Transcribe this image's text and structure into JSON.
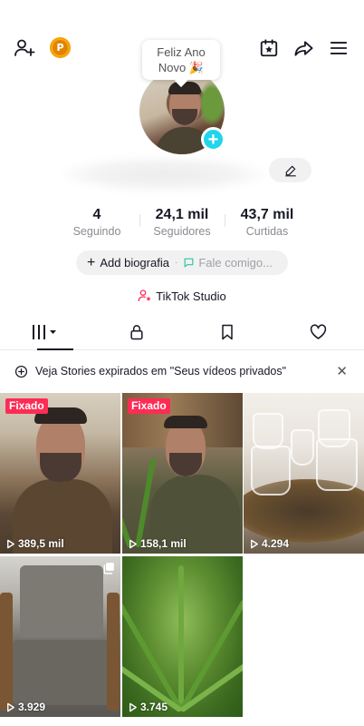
{
  "header": {
    "add_friend_icon": "person-add-icon",
    "coin_letter": "P",
    "calendar_icon": "calendar-star-icon",
    "share_icon": "share-arrow-icon",
    "menu_icon": "hamburger-menu-icon"
  },
  "profile": {
    "note_text_line1": "Feliz Ano",
    "note_text_line2": "Novo 🎉",
    "edit_icon": "pencil-icon",
    "stats": [
      {
        "value": "4",
        "label": "Seguindo"
      },
      {
        "value": "24,1 mil",
        "label": "Seguidores"
      },
      {
        "value": "43,7 mil",
        "label": "Curtidas"
      }
    ],
    "bio_button_label": "Add biografia",
    "bio_separator": "·",
    "bio_message_label": "Fale comigo...",
    "studio_label": "TikTok Studio"
  },
  "tabs": [
    {
      "name": "videos",
      "icon": "grid-bars-icon"
    },
    {
      "name": "private",
      "icon": "lock-icon"
    },
    {
      "name": "saved",
      "icon": "bookmark-icon"
    },
    {
      "name": "liked",
      "icon": "heart-icon"
    }
  ],
  "notice": {
    "text": "Veja Stories expirados em \"Seus vídeos privados\""
  },
  "videos": [
    {
      "pinned_label": "Fixado",
      "views": "389,5 mil"
    },
    {
      "pinned_label": "Fixado",
      "views": "158,1 mil"
    },
    {
      "pinned_label": "",
      "views": "4.294"
    },
    {
      "pinned_label": "",
      "views": "3.929"
    },
    {
      "pinned_label": "",
      "views": "3.745"
    }
  ],
  "colors": {
    "accent_pink": "#fe2c55",
    "avatar_badge": "#20d5ec",
    "coin": "#fbb019",
    "text_primary": "#161823",
    "text_secondary": "#8a8b91"
  }
}
